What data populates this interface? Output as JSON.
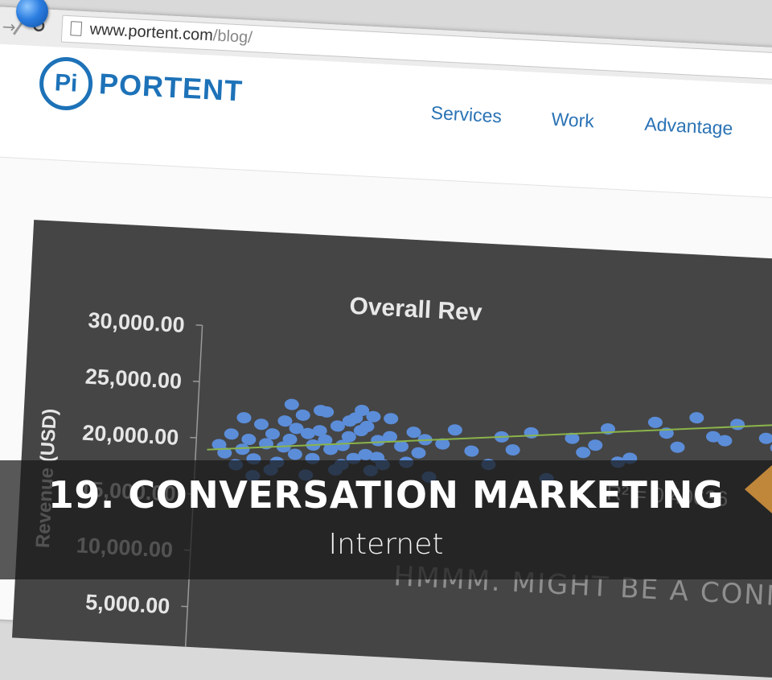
{
  "browser": {
    "url_host": "www.portent.com",
    "url_path": "/blog/"
  },
  "site": {
    "logo_mark": "Pi",
    "logo_text": "PORTENT",
    "nav": [
      "Services",
      "Work",
      "Advantage"
    ]
  },
  "chart_data": {
    "type": "scatter",
    "title": "Overall Rev",
    "ylabel": "Revenue (USD)",
    "ytick_labels": [
      "30,000.00",
      "25,000.00",
      "20,000.00",
      "15,000.00",
      "10,000.00",
      "5,000.00"
    ],
    "ylim": [
      5000,
      30000
    ],
    "trendline": {
      "x": [
        0,
        100
      ],
      "y": [
        19000,
        24000
      ]
    },
    "annotation": "R² = 0.40636",
    "overlay_text": "HMMM. MIGHT BE A CONNECTION...",
    "points": [
      {
        "x": 2,
        "y": 19500
      },
      {
        "x": 3,
        "y": 18800
      },
      {
        "x": 4,
        "y": 20500
      },
      {
        "x": 5,
        "y": 17800
      },
      {
        "x": 6,
        "y": 19200
      },
      {
        "x": 7,
        "y": 20100
      },
      {
        "x": 8,
        "y": 18400
      },
      {
        "x": 9,
        "y": 21500
      },
      {
        "x": 10,
        "y": 19800
      },
      {
        "x": 11,
        "y": 20700
      },
      {
        "x": 12,
        "y": 18200
      },
      {
        "x": 13,
        "y": 21900
      },
      {
        "x": 14,
        "y": 20300
      },
      {
        "x": 15,
        "y": 19000
      },
      {
        "x": 16,
        "y": 22500
      },
      {
        "x": 17,
        "y": 20900
      },
      {
        "x": 18,
        "y": 18700
      },
      {
        "x": 19,
        "y": 21200
      },
      {
        "x": 20,
        "y": 22900
      },
      {
        "x": 21,
        "y": 19600
      },
      {
        "x": 22,
        "y": 21700
      },
      {
        "x": 23,
        "y": 20000
      },
      {
        "x": 24,
        "y": 22200
      },
      {
        "x": 25,
        "y": 18900
      },
      {
        "x": 26,
        "y": 21400
      },
      {
        "x": 27,
        "y": 19300
      },
      {
        "x": 28,
        "y": 22700
      },
      {
        "x": 29,
        "y": 20600
      },
      {
        "x": 30,
        "y": 18500
      },
      {
        "x": 31,
        "y": 21000
      },
      {
        "x": 6,
        "y": 22000
      },
      {
        "x": 8,
        "y": 16900
      },
      {
        "x": 11,
        "y": 17500
      },
      {
        "x": 14,
        "y": 23400
      },
      {
        "x": 17,
        "y": 17200
      },
      {
        "x": 19,
        "y": 23000
      },
      {
        "x": 22,
        "y": 17800
      },
      {
        "x": 24,
        "y": 20800
      },
      {
        "x": 26,
        "y": 23200
      },
      {
        "x": 28,
        "y": 17900
      },
      {
        "x": 13,
        "y": 19600
      },
      {
        "x": 15,
        "y": 21300
      },
      {
        "x": 18,
        "y": 19900
      },
      {
        "x": 20,
        "y": 20400
      },
      {
        "x": 23,
        "y": 18300
      },
      {
        "x": 25,
        "y": 22500
      },
      {
        "x": 27,
        "y": 21800
      },
      {
        "x": 29,
        "y": 19100
      },
      {
        "x": 31,
        "y": 22600
      },
      {
        "x": 33,
        "y": 20200
      },
      {
        "x": 34,
        "y": 18800
      },
      {
        "x": 35,
        "y": 21500
      },
      {
        "x": 36,
        "y": 19700
      },
      {
        "x": 37,
        "y": 20900
      },
      {
        "x": 38,
        "y": 17600
      },
      {
        "x": 40,
        "y": 20600
      },
      {
        "x": 42,
        "y": 21900
      },
      {
        "x": 45,
        "y": 20100
      },
      {
        "x": 48,
        "y": 19000
      },
      {
        "x": 50,
        "y": 21500
      },
      {
        "x": 52,
        "y": 20400
      },
      {
        "x": 55,
        "y": 22000
      },
      {
        "x": 58,
        "y": 18000
      },
      {
        "x": 62,
        "y": 21700
      },
      {
        "x": 64,
        "y": 20500
      },
      {
        "x": 66,
        "y": 21200
      },
      {
        "x": 68,
        "y": 22700
      },
      {
        "x": 70,
        "y": 19800
      },
      {
        "x": 72,
        "y": 20200
      },
      {
        "x": 78,
        "y": 22600
      },
      {
        "x": 80,
        "y": 21400
      },
      {
        "x": 83,
        "y": 24100
      },
      {
        "x": 86,
        "y": 22500
      },
      {
        "x": 90,
        "y": 23700
      },
      {
        "x": 95,
        "y": 22600
      },
      {
        "x": 97,
        "y": 21800
      },
      {
        "x": 99,
        "y": 24300
      },
      {
        "x": 100,
        "y": 25000
      },
      {
        "x": 76,
        "y": 23500
      },
      {
        "x": 88,
        "y": 22200
      }
    ]
  },
  "caption": {
    "title": "19. CONVERSATION MARKETING",
    "subtitle": "Internet"
  },
  "colors": {
    "brand_blue": "#1d72b8",
    "chart_bg": "#454545",
    "point": "#5b8dd9",
    "trendline": "#8bb34a",
    "accent_arrow": "#c0863a"
  }
}
